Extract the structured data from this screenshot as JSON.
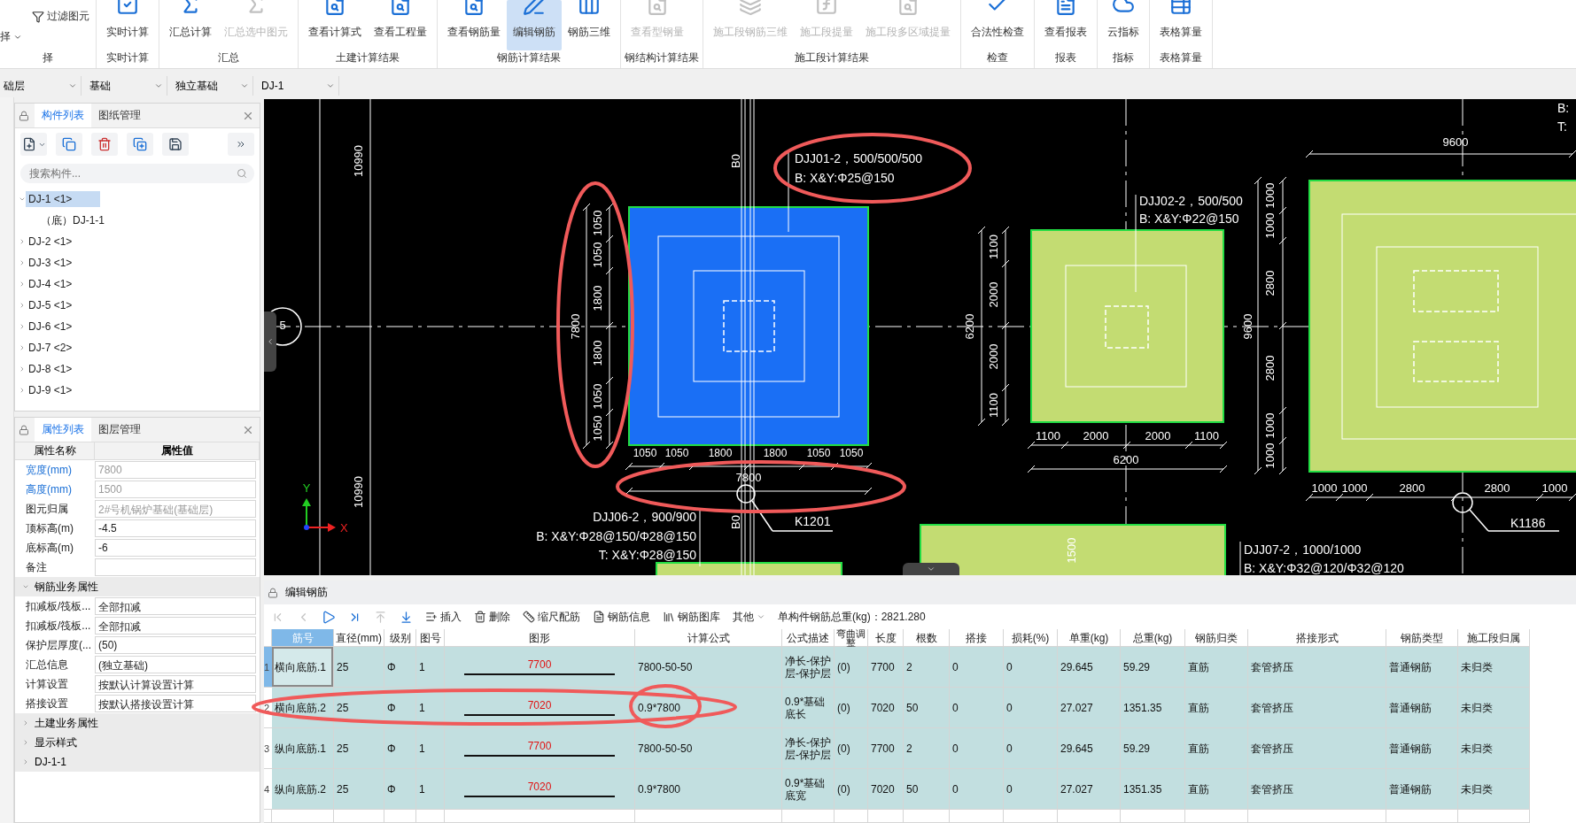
{
  "ribbon": {
    "groups": [
      {
        "label": "择",
        "buttons": [
          {
            "label": "过滤图元",
            "kind": "small",
            "disabled": false,
            "selected": false
          },
          {
            "label": "择",
            "kind": "dropdown",
            "disabled": false,
            "selected": false
          }
        ]
      },
      {
        "label": "实时计算",
        "buttons": [
          {
            "label": "实时计算",
            "kind": "large",
            "disabled": false,
            "selected": false
          }
        ]
      },
      {
        "label": "汇总",
        "buttons": [
          {
            "label": "汇总计算",
            "kind": "large",
            "disabled": false,
            "selected": false
          },
          {
            "label": "汇总选中图元",
            "kind": "large",
            "disabled": true,
            "selected": false
          }
        ]
      },
      {
        "label": "土建计算结果",
        "buttons": [
          {
            "label": "查看计算式",
            "kind": "large",
            "disabled": false,
            "selected": false
          },
          {
            "label": "查看工程量",
            "kind": "large",
            "disabled": false,
            "selected": false
          }
        ]
      },
      {
        "label": "钢筋计算结果",
        "buttons": [
          {
            "label": "查看钢筋量",
            "kind": "large",
            "disabled": false,
            "selected": false
          },
          {
            "label": "编辑钢筋",
            "kind": "large",
            "disabled": false,
            "selected": true
          },
          {
            "label": "钢筋三维",
            "kind": "large",
            "disabled": false,
            "selected": false
          }
        ]
      },
      {
        "label": "钢结构计算结果",
        "buttons": [
          {
            "label": "查看型钢量",
            "kind": "large",
            "disabled": true,
            "selected": false
          }
        ]
      },
      {
        "label": "施工段计算结果",
        "buttons": [
          {
            "label": "施工段钢筋三维",
            "kind": "large",
            "disabled": true,
            "selected": false
          },
          {
            "label": "施工段提量",
            "kind": "large",
            "disabled": true,
            "selected": false
          },
          {
            "label": "施工段多区域提量",
            "kind": "large",
            "disabled": true,
            "selected": false
          }
        ]
      },
      {
        "label": "检查",
        "buttons": [
          {
            "label": "合法性检查",
            "kind": "large",
            "disabled": false,
            "selected": false
          }
        ]
      },
      {
        "label": "报表",
        "buttons": [
          {
            "label": "查看报表",
            "kind": "large",
            "disabled": false,
            "selected": false
          }
        ]
      },
      {
        "label": "指标",
        "buttons": [
          {
            "label": "云指标",
            "kind": "large",
            "disabled": false,
            "selected": false
          }
        ]
      },
      {
        "label": "表格算量",
        "buttons": [
          {
            "label": "表格算量",
            "kind": "large",
            "disabled": false,
            "selected": false
          }
        ]
      }
    ]
  },
  "selectors": [
    "础层",
    "基础",
    "独立基础",
    "DJ-1"
  ],
  "component_panel": {
    "tabs": [
      {
        "label": "构件列表",
        "selected": true
      },
      {
        "label": "图纸管理",
        "selected": false
      }
    ],
    "search": {
      "placeholder": "搜索构件..."
    },
    "tree": [
      {
        "label": "DJ-1 <1>",
        "selected": true,
        "expanded": true,
        "children": [
          {
            "label": "（底）DJ-1-1",
            "selected": false
          }
        ]
      },
      {
        "label": "DJ-2 <1>",
        "selected": false,
        "expanded": false
      },
      {
        "label": "DJ-3 <1>",
        "selected": false,
        "expanded": false
      },
      {
        "label": "DJ-4 <1>",
        "selected": false,
        "expanded": false
      },
      {
        "label": "DJ-5 <1>",
        "selected": false,
        "expanded": false
      },
      {
        "label": "DJ-6 <1>",
        "selected": false,
        "expanded": false
      },
      {
        "label": "DJ-7 <2>",
        "selected": false,
        "expanded": false
      },
      {
        "label": "DJ-8 <1>",
        "selected": false,
        "expanded": false
      },
      {
        "label": "DJ-9 <1>",
        "selected": false,
        "expanded": false
      }
    ]
  },
  "property_panel": {
    "tabs": [
      {
        "label": "属性列表",
        "selected": true
      },
      {
        "label": "图层管理",
        "selected": false
      }
    ],
    "columns": [
      "属性名称",
      "属性值"
    ],
    "rows": [
      {
        "kind": "prop",
        "name": "宽度(mm)",
        "value": "7800",
        "highlighted": true,
        "disabled": true
      },
      {
        "kind": "prop",
        "name": "高度(mm)",
        "value": "1500",
        "highlighted": true,
        "disabled": true
      },
      {
        "kind": "prop",
        "name": "图元归属",
        "value": "2#号机锅炉基础(基础层)",
        "highlighted": false,
        "disabled": true
      },
      {
        "kind": "prop",
        "name": "顶标高(m)",
        "value": "-4.5",
        "highlighted": false,
        "disabled": false
      },
      {
        "kind": "prop",
        "name": "底标高(m)",
        "value": "-6",
        "highlighted": false,
        "disabled": false
      },
      {
        "kind": "prop",
        "name": "备注",
        "highlighted": false
      },
      {
        "kind": "group",
        "name": "钢筋业务属性",
        "expanded": true
      },
      {
        "kind": "prop",
        "name": "扣减板/筏板...",
        "value": "全部扣减",
        "highlighted": false,
        "disabled": false
      },
      {
        "kind": "prop",
        "name": "扣减板/筏板...",
        "value": "全部扣减",
        "highlighted": false,
        "disabled": false
      },
      {
        "kind": "prop",
        "name": "保护层厚度(...",
        "value": "(50)",
        "highlighted": false,
        "disabled": false
      },
      {
        "kind": "prop",
        "name": "汇总信息",
        "value": "(独立基础)",
        "highlighted": false,
        "disabled": false
      },
      {
        "kind": "prop",
        "name": "计算设置",
        "value": "按默认计算设置计算",
        "highlighted": false,
        "disabled": false
      },
      {
        "kind": "prop",
        "name": "搭接设置",
        "value": "按默认搭接设置计算",
        "highlighted": false,
        "disabled": false
      },
      {
        "kind": "group",
        "name": "土建业务属性",
        "expanded": false
      },
      {
        "kind": "group",
        "name": "显示样式",
        "expanded": false
      },
      {
        "kind": "group",
        "name": "DJ-1-1",
        "expanded": false
      }
    ]
  },
  "cad": {
    "footings": [
      {
        "selected": true
      },
      {
        "selected": false
      },
      {
        "selected": false
      },
      {
        "selected": false
      },
      {
        "selected": false
      }
    ],
    "labels": [
      "10990",
      "10990",
      "B0",
      "B0",
      "5",
      "DJJ01-2，500/500/500",
      "B: X&Y:Φ25@150",
      "1050",
      "1050",
      "1800",
      "1800",
      "1050",
      "1050",
      "7800",
      "1050",
      "1050",
      "1800",
      "1800",
      "1050",
      "1050",
      "7800",
      "DJJ06-2，900/900",
      "K1201",
      "B: X&Y:Φ28@150/Φ28@150",
      "T: X&Y:Φ28@150",
      "DJJ02-2，500/500",
      "B: X&Y:Φ22@150",
      "1100",
      "2000",
      "2000",
      "1100",
      "6200",
      "1100",
      "2000",
      "2000",
      "1100",
      "6200",
      "9600",
      "1000",
      "1000",
      "2800",
      "2800",
      "1000",
      "1000",
      "9600",
      "1000",
      "1000",
      "2800",
      "2800",
      "1000",
      "K1186",
      "DJJ07-2，1000/1000",
      "B: X&Y:Φ32@120/Φ32@120",
      "1500",
      "B:",
      "T:"
    ],
    "ucs": {
      "x_label": "X",
      "y_label": "Y"
    }
  },
  "rebar_editor": {
    "title": "编辑钢筋",
    "nav_buttons": [
      {
        "kind": "first",
        "disabled": true
      },
      {
        "kind": "prev",
        "disabled": true
      },
      {
        "kind": "next",
        "disabled": false
      },
      {
        "kind": "last",
        "disabled": false
      },
      {
        "kind": "up",
        "disabled": true
      },
      {
        "kind": "down",
        "disabled": false
      }
    ],
    "actions": [
      {
        "kind": "insert",
        "label": "插入"
      },
      {
        "kind": "delete",
        "label": "删除"
      },
      {
        "kind": "scale",
        "label": "缩尺配筋"
      },
      {
        "kind": "info",
        "label": "钢筋信息"
      },
      {
        "kind": "library",
        "label": "钢筋图库"
      },
      {
        "kind": "menu",
        "label": "其他"
      }
    ],
    "total": "单构件钢筋总重(kg)：2821.280",
    "columns": [
      {
        "label": "筋号",
        "kind": "text",
        "selected": true
      },
      {
        "label": "直径(mm)",
        "kind": "text",
        "selected": false
      },
      {
        "label": "级别",
        "kind": "text",
        "selected": false
      },
      {
        "label": "图号",
        "kind": "text",
        "selected": false
      },
      {
        "label": "图形",
        "kind": "shape",
        "selected": false
      },
      {
        "label": "计算公式",
        "kind": "text",
        "selected": false
      },
      {
        "label": "公式描述",
        "kind": "text",
        "selected": false
      },
      {
        "label": "弯曲调整",
        "kind": "text",
        "selected": false
      },
      {
        "label": "长度",
        "kind": "text",
        "selected": false
      },
      {
        "label": "根数",
        "kind": "text",
        "selected": false
      },
      {
        "label": "搭接",
        "kind": "text",
        "selected": false
      },
      {
        "label": "损耗(%)",
        "kind": "text",
        "selected": false
      },
      {
        "label": "单重(kg)",
        "kind": "text",
        "selected": false
      },
      {
        "label": "总重(kg)",
        "kind": "text",
        "selected": false
      },
      {
        "label": "钢筋归类",
        "kind": "text",
        "selected": false
      },
      {
        "label": "搭接形式",
        "kind": "text",
        "selected": false
      },
      {
        "label": "钢筋类型",
        "kind": "text",
        "selected": false
      },
      {
        "label": "施工段归属",
        "kind": "text",
        "selected": false
      }
    ],
    "rows": [
      {
        "number": "1",
        "selected": true,
        "cells": [
          "横向底筋.1",
          "25",
          "Φ",
          "1",
          "7700",
          "7800-50-50",
          "净长-保护层-保护层",
          "(0)",
          "7700",
          "2",
          "0",
          "0",
          "29.645",
          "59.29",
          "直筋",
          "套管挤压",
          "普通钢筋",
          "未归类"
        ]
      },
      {
        "number": "2",
        "selected": false,
        "cells": [
          "横向底筋.2",
          "25",
          "Φ",
          "1",
          "7020",
          "0.9*7800",
          "0.9*基础底长",
          "(0)",
          "7020",
          "50",
          "0",
          "0",
          "27.027",
          "1351.35",
          "直筋",
          "套管挤压",
          "普通钢筋",
          "未归类"
        ]
      },
      {
        "number": "3",
        "selected": false,
        "cells": [
          "纵向底筋.1",
          "25",
          "Φ",
          "1",
          "7700",
          "7800-50-50",
          "净长-保护层-保护层",
          "(0)",
          "7700",
          "2",
          "0",
          "0",
          "29.645",
          "59.29",
          "直筋",
          "套管挤压",
          "普通钢筋",
          "未归类"
        ]
      },
      {
        "number": "4",
        "selected": false,
        "cells": [
          "纵向底筋.2",
          "25",
          "Φ",
          "1",
          "7020",
          "0.9*7800",
          "0.9*基础底宽",
          "(0)",
          "7020",
          "50",
          "0",
          "0",
          "27.027",
          "1351.35",
          "直筋",
          "套管挤压",
          "普通钢筋",
          "未归类"
        ]
      }
    ]
  }
}
